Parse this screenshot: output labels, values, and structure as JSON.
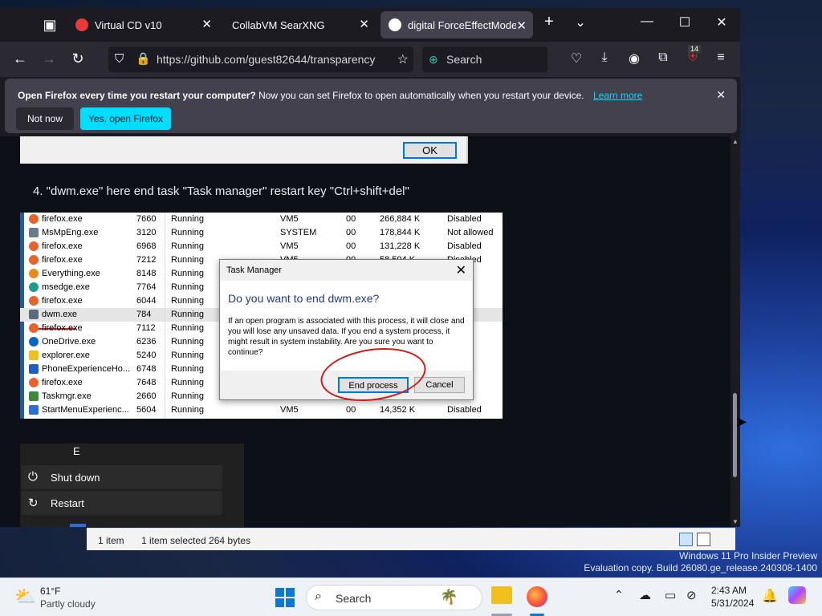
{
  "browser": {
    "tabs": [
      {
        "label": "Virtual CD v10"
      },
      {
        "label": "CollabVM SearXNG"
      },
      {
        "label": "digital ForceEffectMode.i"
      }
    ],
    "url": "https://github.com/guest82644/transparency",
    "search_placeholder": "Search",
    "extension_badge": "14"
  },
  "notification": {
    "bold": "Open Firefox every time you restart your computer?",
    "text": "Now you can set Firefox to open automatically when you restart your device.",
    "link": "Learn more",
    "btn_notnow": "Not now",
    "btn_yes": "Yes, open Firefox"
  },
  "page": {
    "ok_label": "OK",
    "step_text": "4. \"dwm.exe\" here end task \"Task manager\" restart key \"Ctrl+shift+del\"",
    "processes": [
      {
        "name": "firefox.exe",
        "pid": "7660",
        "status": "Running",
        "user": "VM5",
        "cpu": "00",
        "mem": "266,884 K",
        "uac": "Disabled",
        "color": "#e8622a"
      },
      {
        "name": "MsMpEng.exe",
        "pid": "3120",
        "status": "Running",
        "user": "SYSTEM",
        "cpu": "00",
        "mem": "178,844 K",
        "uac": "Not allowed",
        "color": "#6b7a8f"
      },
      {
        "name": "firefox.exe",
        "pid": "6968",
        "status": "Running",
        "user": "VM5",
        "cpu": "00",
        "mem": "131,228 K",
        "uac": "Disabled",
        "color": "#e8622a"
      },
      {
        "name": "firefox.exe",
        "pid": "7212",
        "status": "Running",
        "user": "VM5",
        "cpu": "00",
        "mem": "58,504 K",
        "uac": "Disabled",
        "color": "#e8622a"
      },
      {
        "name": "Everything.exe",
        "pid": "8148",
        "status": "Running",
        "user": "",
        "cpu": "",
        "mem": "",
        "uac": "",
        "color": "#e88a1a"
      },
      {
        "name": "msedge.exe",
        "pid": "7764",
        "status": "Running",
        "user": "",
        "cpu": "",
        "mem": "",
        "uac": "",
        "color": "#1a9e8a"
      },
      {
        "name": "firefox.exe",
        "pid": "6044",
        "status": "Running",
        "user": "",
        "cpu": "",
        "mem": "",
        "uac": "",
        "color": "#e8622a"
      },
      {
        "name": "dwm.exe",
        "pid": "784",
        "status": "Running",
        "user": "",
        "cpu": "",
        "mem": "",
        "uac": "",
        "color": "#5a6b80"
      },
      {
        "name": "firefox.exe",
        "pid": "7112",
        "status": "Running",
        "user": "",
        "cpu": "",
        "mem": "",
        "uac": "",
        "color": "#e8622a"
      },
      {
        "name": "OneDrive.exe",
        "pid": "6236",
        "status": "Running",
        "user": "",
        "cpu": "",
        "mem": "",
        "uac": "",
        "color": "#0a64c8"
      },
      {
        "name": "explorer.exe",
        "pid": "5240",
        "status": "Running",
        "user": "",
        "cpu": "",
        "mem": "",
        "uac": "",
        "color": "#f2c01e"
      },
      {
        "name": "PhoneExperienceHo...",
        "pid": "6748",
        "status": "Running",
        "user": "",
        "cpu": "",
        "mem": "",
        "uac": "",
        "color": "#1f5fbf"
      },
      {
        "name": "firefox.exe",
        "pid": "7648",
        "status": "Running",
        "user": "",
        "cpu": "",
        "mem": "",
        "uac": "",
        "color": "#e8622a"
      },
      {
        "name": "Taskmgr.exe",
        "pid": "2660",
        "status": "Running",
        "user": "",
        "cpu": "",
        "mem": "",
        "uac": "",
        "color": "#3b8a3b"
      },
      {
        "name": "StartMenuExperienc...",
        "pid": "5604",
        "status": "Running",
        "user": "VM5",
        "cpu": "00",
        "mem": "14,352 K",
        "uac": "Disabled",
        "color": "#2b6fd6"
      }
    ],
    "dialog": {
      "title": "Task Manager",
      "heading": "Do you want to end dwm.exe?",
      "body": "If an open program is associated with this process, it will close and you will lose any unsaved data. If you end a system process, it might result in system instability. Are you sure you want to continue?",
      "end_process": "End process",
      "cancel": "Cancel"
    },
    "power_menu": {
      "letter": "E",
      "shutdown": "Shut down",
      "restart": "Restart"
    }
  },
  "explorer_status": {
    "items": "1 item",
    "selected": "1 item selected  264 bytes"
  },
  "watermark": {
    "line1": "Windows 11 Pro Insider Preview",
    "line2": "Evaluation copy. Build 26080.ge_release.240308-1400"
  },
  "taskbar": {
    "weather_temp": "61°F",
    "weather_desc": "Partly cloudy",
    "search": "Search",
    "time": "2:43 AM",
    "date": "5/31/2024"
  }
}
